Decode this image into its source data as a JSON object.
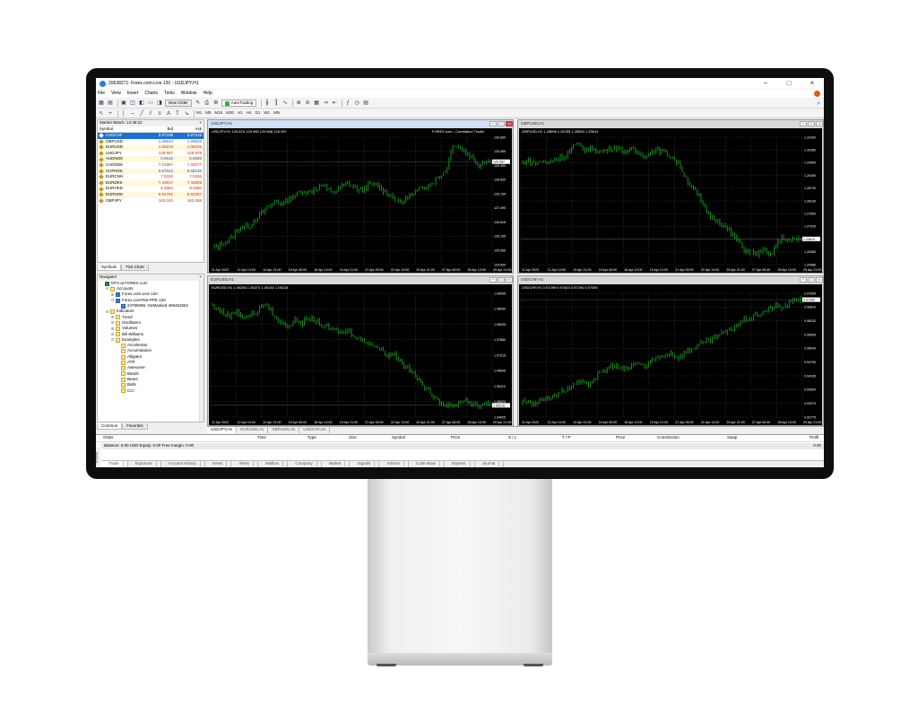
{
  "window": {
    "title": "20638271: Forex.com-Live 120 - USDJPY,H1"
  },
  "menu": [
    "File",
    "View",
    "Insert",
    "Charts",
    "Tools",
    "Window",
    "Help"
  ],
  "toolbar": {
    "new_order_label": "New Order",
    "autotrading_label": "AutoTrading"
  },
  "timeframes": [
    "M1",
    "M5",
    "M15",
    "M30",
    "H1",
    "H4",
    "D1",
    "W1",
    "MN"
  ],
  "market_watch": {
    "title": "Market Watch: 14:46:22",
    "headers": {
      "symbol": "Symbol",
      "bid": "Bid",
      "ask": "Ask"
    },
    "rows": [
      {
        "symbol": "USDCHF",
        "bid": "0.97199",
        "ask": "0.97219",
        "dir": "up",
        "selected": true
      },
      {
        "symbol": "GBPUSD",
        "bid": "1.25614",
        "ask": "1.25633",
        "dir": "up"
      },
      {
        "symbol": "EURUSD",
        "bid": "1.05218",
        "ask": "1.05226",
        "dir": "dn"
      },
      {
        "symbol": "USDJPY",
        "bid": "129.957",
        "ask": "129.979",
        "dir": "dn"
      },
      {
        "symbol": "AUDNOK",
        "bid": "6.6616",
        "ask": "6.6656",
        "dir": "up"
      },
      {
        "symbol": "CADNOK",
        "bid": "7.31987",
        "ask": "7.32077",
        "dir": "dn"
      },
      {
        "symbol": "CHFNOK",
        "bid": "9.67642",
        "ask": "9.68135",
        "dir": "up"
      },
      {
        "symbol": "EURCNH",
        "bid": "7.0220",
        "ask": "7.0256",
        "dir": "dn"
      },
      {
        "symbol": "EURDKK",
        "bid": "7.43917",
        "ask": "7.43959",
        "dir": "dn"
      },
      {
        "symbol": "EURHKD",
        "bid": "8.2564",
        "ask": "8.2580",
        "dir": "dn"
      },
      {
        "symbol": "EURNOK",
        "bid": "9.91752",
        "ask": "9.92287",
        "dir": "dn"
      },
      {
        "symbol": "GBPJPY",
        "bid": "163.242",
        "ask": "163.288",
        "dir": "dn"
      }
    ],
    "tabs": [
      "Symbols",
      "Tick Chart"
    ]
  },
  "navigator": {
    "title": "Navigator",
    "items": [
      {
        "label": "MT4 at FOREX.com",
        "level": 0,
        "type": "root"
      },
      {
        "label": "Accounts",
        "level": 1,
        "type": "folder",
        "tw": "−"
      },
      {
        "label": "Forex.com-Live 120",
        "level": 2,
        "type": "acc",
        "tw": "+"
      },
      {
        "label": "Forex.comTest-PPE 120",
        "level": 2,
        "type": "acc",
        "tw": "−"
      },
      {
        "label": "24789286: GeMasked 406462652",
        "level": 3,
        "type": "acc"
      },
      {
        "label": "Indicators",
        "level": 1,
        "type": "folder",
        "tw": "−"
      },
      {
        "label": "Trend",
        "level": 2,
        "type": "folder",
        "tw": "+"
      },
      {
        "label": "Oscillators",
        "level": 2,
        "type": "folder",
        "tw": "+"
      },
      {
        "label": "Volumes",
        "level": 2,
        "type": "folder",
        "tw": "+"
      },
      {
        "label": "Bill Williams",
        "level": 2,
        "type": "folder",
        "tw": "+"
      },
      {
        "label": "Examples",
        "level": 2,
        "type": "folder",
        "tw": "−"
      },
      {
        "label": "Accelerator",
        "level": 3,
        "type": "folder"
      },
      {
        "label": "Accumulation",
        "level": 3,
        "type": "folder"
      },
      {
        "label": "Alligator",
        "level": 3,
        "type": "folder"
      },
      {
        "label": "ATR",
        "level": 3,
        "type": "folder"
      },
      {
        "label": "Awesome",
        "level": 3,
        "type": "folder"
      },
      {
        "label": "Bands",
        "level": 3,
        "type": "folder"
      },
      {
        "label": "Bears",
        "level": 3,
        "type": "folder"
      },
      {
        "label": "Bulls",
        "level": 3,
        "type": "folder"
      },
      {
        "label": "CCI",
        "level": 3,
        "type": "folder"
      }
    ],
    "tabs": [
      "Common",
      "Favorites"
    ]
  },
  "charts": [
    {
      "title": "USDJPY,H1",
      "info": "USDJPY,H1  129.876 129.998 129.848 129.957",
      "oneclick": "FOREX.com - Correlation Trader",
      "active": true,
      "yticks": [
        "130.890",
        "130.065",
        "129.490",
        "128.830",
        "128.155",
        "127.490",
        "126.815",
        "126.155",
        "125.505",
        "124.830"
      ],
      "price_tag": "129.957",
      "xticks": [
        "11 Apr 2022",
        "12 Apr 13:00",
        "13 Apr 21:00",
        "15 Apr 05:00",
        "18 Apr 13:00",
        "19 Apr 21:00",
        "21 Apr 05:00",
        "22 Apr 13:00",
        "25 Apr 21:00",
        "27 Apr 05:00",
        "28 Apr 13:00",
        "29 Apr 21:00"
      ],
      "series": [
        0.12,
        0.14,
        0.18,
        0.2,
        0.27,
        0.3,
        0.3,
        0.37,
        0.41,
        0.46,
        0.5,
        0.48,
        0.52,
        0.55,
        0.58,
        0.56,
        0.6,
        0.62,
        0.58,
        0.57,
        0.61,
        0.64,
        0.6,
        0.58,
        0.62,
        0.63,
        0.6,
        0.56,
        0.52,
        0.48,
        0.53,
        0.55,
        0.6,
        0.62,
        0.65,
        0.7,
        0.74,
        0.95,
        0.92,
        0.88,
        0.84,
        0.78,
        0.82,
        0.8
      ]
    },
    {
      "title": "GBPUSD,H1",
      "info": "GBPUSD,H1  1.25698 1.25765 1.25553 1.25614",
      "active": false,
      "yticks": [
        "1.31000",
        "1.30380",
        "1.29900",
        "1.29250",
        "1.28730",
        "1.28130",
        "1.27600",
        "1.27030",
        "1.26020",
        "1.25480",
        "1.24980"
      ],
      "price_tag": "1.25614",
      "xticks": [
        "11 Apr 2022",
        "12 Apr 13:00",
        "13 Apr 21:00",
        "15 Apr 05:00",
        "18 Apr 13:00",
        "19 Apr 21:00",
        "21 Apr 05:00",
        "22 Apr 13:00",
        "25 Apr 21:00",
        "27 Apr 05:00",
        "28 Apr 13:00",
        "29 Apr 21:00"
      ],
      "series": [
        0.8,
        0.82,
        0.79,
        0.81,
        0.8,
        0.82,
        0.84,
        0.86,
        0.93,
        0.94,
        0.9,
        0.92,
        0.88,
        0.9,
        0.92,
        0.91,
        0.89,
        0.9,
        0.88,
        0.86,
        0.89,
        0.9,
        0.88,
        0.85,
        0.8,
        0.7,
        0.62,
        0.55,
        0.45,
        0.38,
        0.35,
        0.3,
        0.25,
        0.2,
        0.12,
        0.1,
        0.08,
        0.12,
        0.06,
        0.15,
        0.22,
        0.18,
        0.2,
        0.2
      ]
    },
    {
      "title": "EURUSD,H1",
      "info": "EURUSD,H1  1.05258 1.05273 1.05160 1.05218",
      "active": false,
      "yticks": [
        "1.09095",
        "1.08060",
        "1.08005",
        "1.07660",
        "1.07215",
        "1.06605",
        "1.06110",
        "1.05623",
        "1.04625"
      ],
      "price_tag": "1.05218",
      "xticks": [
        "11 Apr 2022",
        "12 Apr 13:00",
        "13 Apr 21:00",
        "15 Apr 05:00",
        "18 Apr 13:00",
        "19 Apr 21:00",
        "21 Apr 05:00",
        "22 Apr 13:00",
        "25 Apr 21:00",
        "27 Apr 05:00",
        "28 Apr 13:00",
        "29 Apr 21:00"
      ],
      "series": [
        0.9,
        0.88,
        0.84,
        0.82,
        0.86,
        0.8,
        0.82,
        0.85,
        0.92,
        0.88,
        0.78,
        0.76,
        0.74,
        0.78,
        0.76,
        0.8,
        0.78,
        0.74,
        0.72,
        0.7,
        0.68,
        0.7,
        0.66,
        0.62,
        0.6,
        0.58,
        0.55,
        0.5,
        0.52,
        0.45,
        0.4,
        0.35,
        0.28,
        0.22,
        0.18,
        0.12,
        0.1,
        0.08,
        0.12,
        0.14,
        0.1,
        0.08,
        0.12,
        0.1
      ]
    },
    {
      "title": "USDCHF,H1",
      "info": "USDCHF,H1  0.97299 0.97403 0.97294 0.97390",
      "active": false,
      "yticks": [
        "0.97695",
        "0.96810",
        "0.96232",
        "0.95605",
        "0.95040",
        "0.94790",
        "0.94195",
        "0.93600",
        "0.93270",
        "0.92775"
      ],
      "price_tag": "0.97390",
      "xticks": [
        "11 Apr 2022",
        "12 Apr 13:00",
        "13 Apr 21:00",
        "15 Apr 05:00",
        "18 Apr 13:00",
        "19 Apr 21:00",
        "21 Apr 05:00",
        "22 Apr 13:00",
        "25 Apr 21:00",
        "27 Apr 05:00",
        "28 Apr 13:00",
        "29 Apr 21:00"
      ],
      "series": [
        0.12,
        0.14,
        0.1,
        0.15,
        0.14,
        0.18,
        0.2,
        0.22,
        0.26,
        0.28,
        0.25,
        0.3,
        0.35,
        0.38,
        0.42,
        0.4,
        0.38,
        0.42,
        0.44,
        0.4,
        0.45,
        0.48,
        0.5,
        0.52,
        0.48,
        0.52,
        0.55,
        0.58,
        0.6,
        0.62,
        0.65,
        0.68,
        0.7,
        0.75,
        0.78,
        0.8,
        0.82,
        0.85,
        0.88,
        0.9,
        0.88,
        0.92,
        0.95,
        0.96
      ]
    }
  ],
  "chart_tabs": [
    "USDJPY,H1",
    "EURUSD,H1",
    "GBPUSD,H1",
    "USDCHF,H1"
  ],
  "terminal": {
    "columns": [
      "Order",
      "Time",
      "Type",
      "Size",
      "Symbol",
      "Price",
      "S / L",
      "T / P",
      "Price",
      "Commission",
      "Swap",
      "Profit"
    ],
    "balance_text": "Balance: 0.00 USD  Equity: 0.00  Free margin: 0.00",
    "profit_value": "0.00",
    "side_label": "Terminal",
    "tabs": [
      "Trade",
      "Exposure",
      "Account History",
      "News",
      "Alerts",
      "Mailbox",
      "Company",
      "Market",
      "Signals",
      "Articles",
      "Code Base",
      "Experts",
      "Journal"
    ]
  },
  "colors": {
    "chart_bg": "#000000",
    "candle": "#16a31c",
    "grid": "#5a5a5a",
    "selected": "#1d6fd1"
  }
}
